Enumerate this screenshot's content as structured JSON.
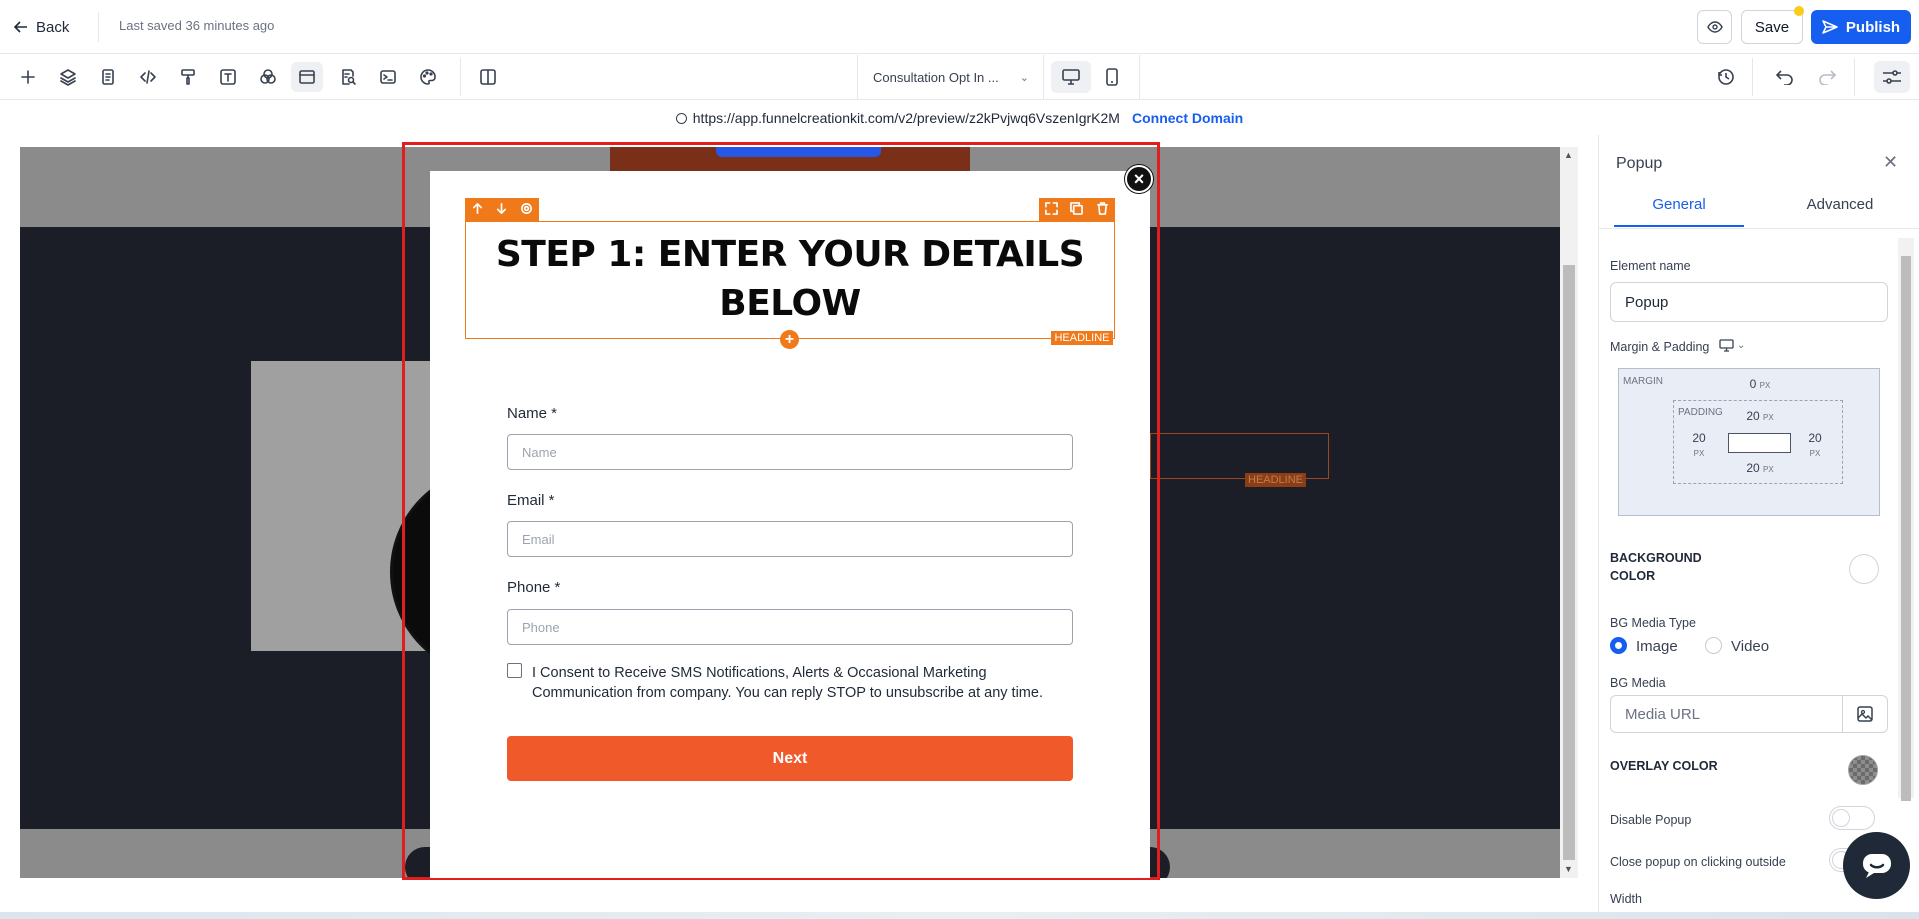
{
  "topbar": {
    "back_label": "Back",
    "last_saved": "Last saved 36 minutes ago",
    "save_label": "Save",
    "publish_label": "Publish"
  },
  "toolbar": {
    "tools": [
      "add-icon",
      "layers-icon",
      "page-icon",
      "code-icon",
      "paint-roller-icon",
      "text-icon",
      "circles-icon",
      "popup-icon",
      "search-doc-icon",
      "terminal-icon",
      "palette-icon",
      "split-view-icon"
    ],
    "page_select": "Consultation Opt In ...",
    "active_device": "desktop"
  },
  "urlbar": {
    "url": "https://app.funnelcreationkit.com/v2/preview/z2kPvjwq6VszenIgrK2M",
    "connect_label": "Connect Domain"
  },
  "canvas": {
    "bg_headline_tag": "HEADLINE"
  },
  "popup": {
    "headline": "STEP 1: ENTER YOUR DETAILS BELOW",
    "headline_tag": "HEADLINE",
    "fields": [
      {
        "label": "Name *",
        "placeholder": "Name",
        "value": ""
      },
      {
        "label": "Email *",
        "placeholder": "Email",
        "value": ""
      },
      {
        "label": "Phone *",
        "placeholder": "Phone",
        "value": ""
      }
    ],
    "consent_text": "I Consent to Receive SMS Notifications, Alerts & Occasional Marketing Communication from company. You can reply STOP to unsubscribe at any time.",
    "consent_checked": false,
    "next_label": "Next",
    "accent_color": "#f0592a",
    "selection_color": "#f07a1a"
  },
  "panel": {
    "title": "Popup",
    "tabs": [
      "General",
      "Advanced"
    ],
    "active_tab": "General",
    "element_name_label": "Element name",
    "element_name_value": "Popup",
    "margin_padding_label": "Margin & Padding",
    "margin_label": "MARGIN",
    "margin_top": "0",
    "padding_label": "PADDING",
    "padding_top": "20",
    "padding_left": "20",
    "padding_right": "20",
    "padding_bottom": "20",
    "unit": "PX",
    "bg_color_label": "BACKGROUND COLOR",
    "bg_media_type_label": "BG Media Type",
    "media_options": [
      "Image",
      "Video"
    ],
    "media_selected": "Image",
    "bg_media_label": "BG Media",
    "media_url_placeholder": "Media URL",
    "overlay_label": "OVERLAY COLOR",
    "disable_popup_label": "Disable Popup",
    "disable_popup_on": false,
    "close_outside_label": "Close popup on clicking outside",
    "width_label": "Width"
  },
  "colors": {
    "brand_blue": "#155eef",
    "dark_section": "#1b1e27"
  }
}
